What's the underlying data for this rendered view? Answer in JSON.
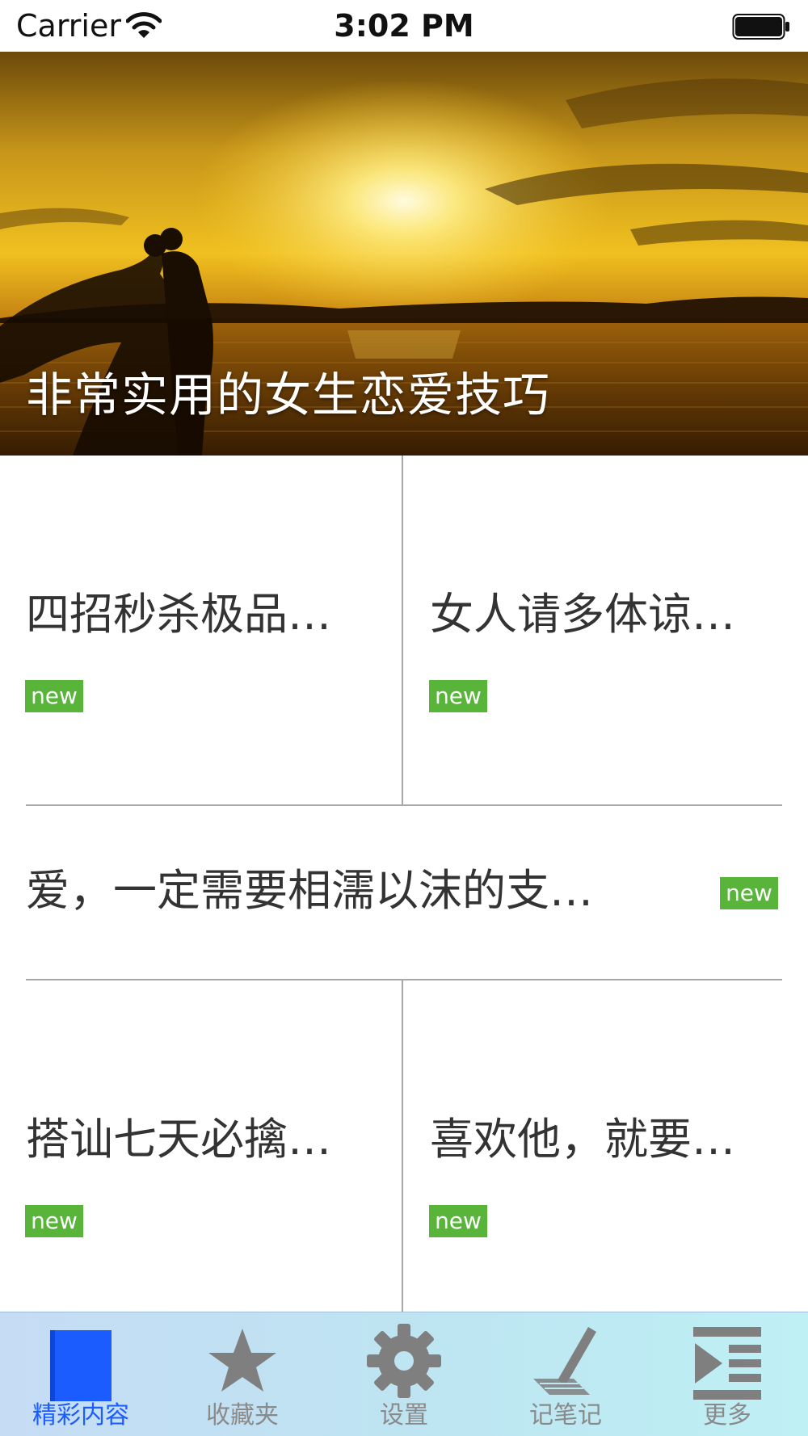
{
  "status_bar": {
    "carrier": "Carrier",
    "time": "3:02 PM"
  },
  "hero": {
    "title": "非常实用的女生恋爱技巧"
  },
  "articles": [
    {
      "title": "四招秒杀极品…",
      "badge": "new"
    },
    {
      "title": "女人请多体谅…",
      "badge": "new"
    },
    {
      "title": "爱，一定需要相濡以沫的支…",
      "badge": "new"
    },
    {
      "title": "搭讪七天必擒…",
      "badge": "new"
    },
    {
      "title": "喜欢他，就要…",
      "badge": "new"
    }
  ],
  "tabs": [
    {
      "label": "精彩内容",
      "icon": "book-icon",
      "active": true
    },
    {
      "label": "收藏夹",
      "icon": "star-icon",
      "active": false
    },
    {
      "label": "设置",
      "icon": "gear-icon",
      "active": false
    },
    {
      "label": "记笔记",
      "icon": "pen-icon",
      "active": false
    },
    {
      "label": "更多",
      "icon": "more-list-icon",
      "active": false
    }
  ],
  "colors": {
    "badge": "#58b53a",
    "tab_active": "#1a5cff",
    "tab_inactive": "#8a8a8a",
    "divider": "#a8a8a8"
  }
}
